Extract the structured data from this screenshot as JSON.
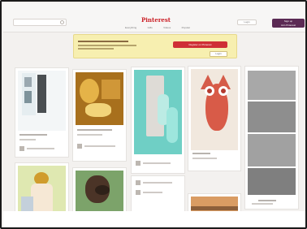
{
  "header": {
    "logo": "Pinterest",
    "nav": [
      "Everything",
      "Gifts",
      "Videos",
      "Popular"
    ],
    "login": "Login",
    "signup_line1": "Sign up",
    "signup_line2": "Join Pinterest"
  },
  "banner": {
    "button": "Register on Pinterest",
    "secondary": "Login"
  },
  "pins": [
    {
      "color": "#3f484b"
    },
    {
      "color": "#b07a1d"
    },
    {
      "color": "#7fd7ce"
    },
    {
      "color": "#d8604b"
    },
    {
      "color": "#777777"
    },
    {
      "color": "#c8a85b"
    },
    {
      "color": "#4b3427"
    },
    {
      "color": "#dfa064"
    }
  ]
}
